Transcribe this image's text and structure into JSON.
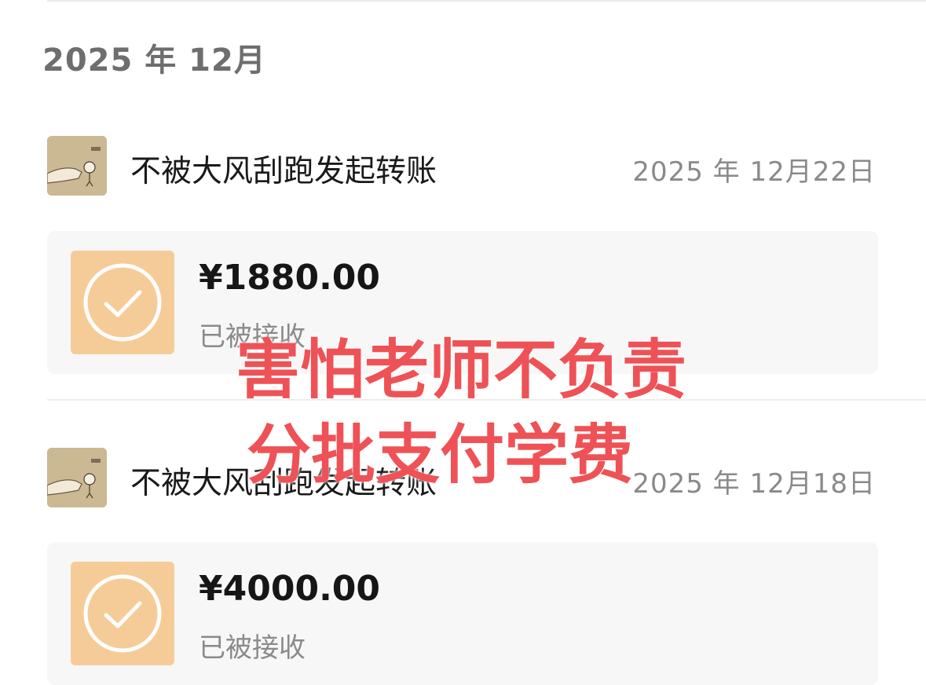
{
  "month_header": "2025 年 12月",
  "records": [
    {
      "title": "不被大风刮跑发起转账",
      "date": "2025 年 12月22日",
      "amount": "¥1880.00",
      "status": "已被接收"
    },
    {
      "title": "不被大风刮跑发起转账",
      "date": "2025 年 12月18日",
      "amount": "¥4000.00",
      "status": "已被接收"
    }
  ],
  "overlay": {
    "line1": "害怕老师不负责",
    "line2": "分批支付学费"
  },
  "colors": {
    "check_tile": "#f5cc98",
    "overlay_text": "#ee5256",
    "card_bg": "#f7f7f7"
  }
}
